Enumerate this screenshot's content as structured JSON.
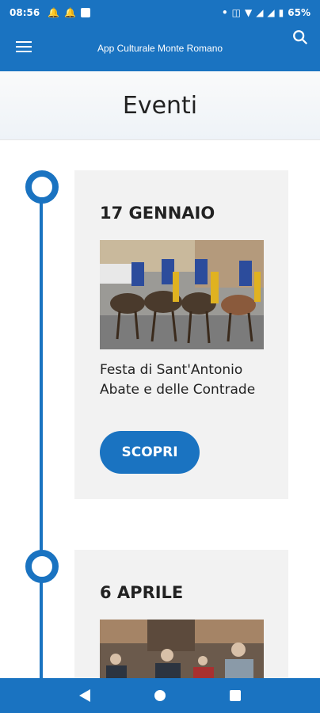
{
  "status": {
    "time": "08:56",
    "battery": "65%",
    "left_icons": [
      "bell-icon",
      "bell-icon",
      "square-icon"
    ],
    "right_icons": [
      "dot-icon",
      "vibrate-icon",
      "wifi-icon",
      "signal-icon",
      "signal-icon",
      "battery-icon"
    ]
  },
  "appbar": {
    "title": "App Culturale Monte Romano"
  },
  "page": {
    "title": "Eventi"
  },
  "colors": {
    "primary": "#1a73c1",
    "card_bg": "#f2f2f2"
  },
  "events": [
    {
      "date": "17 GENNAIO",
      "title": "Festa di Sant'Antonio Abate e delle Contrade",
      "button": "SCOPRI"
    },
    {
      "date": "6 APRILE"
    }
  ]
}
